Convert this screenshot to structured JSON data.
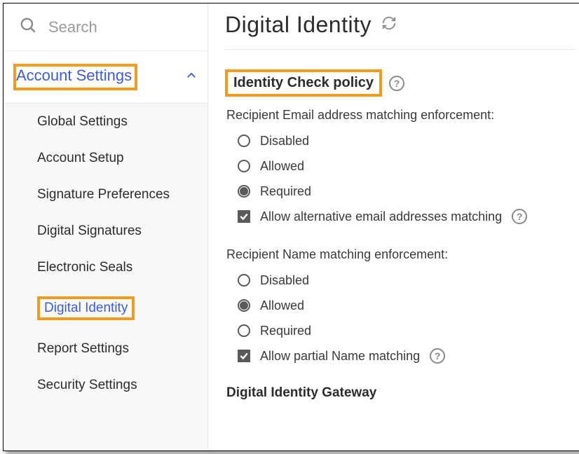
{
  "highlight_color": "#f29b1d",
  "primary_color": "#3b5be0",
  "sidebar": {
    "search_placeholder": "Search",
    "section_label": "Account Settings",
    "items": [
      {
        "label": "Global Settings",
        "active": false
      },
      {
        "label": "Account Setup",
        "active": false
      },
      {
        "label": "Signature Preferences",
        "active": false
      },
      {
        "label": "Digital Signatures",
        "active": false
      },
      {
        "label": "Electronic Seals",
        "active": false
      },
      {
        "label": "Digital Identity",
        "active": true
      },
      {
        "label": "Report Settings",
        "active": false
      },
      {
        "label": "Security Settings",
        "active": false
      }
    ]
  },
  "main": {
    "title": "Digital Identity",
    "identity_check": {
      "title": "Identity Check policy",
      "email_group_label": "Recipient Email address matching enforcement:",
      "email_options": [
        {
          "label": "Disabled",
          "selected": false
        },
        {
          "label": "Allowed",
          "selected": false
        },
        {
          "label": "Required",
          "selected": true
        }
      ],
      "email_allow_alt": {
        "label": "Allow alternative email addresses matching",
        "checked": true
      },
      "name_group_label": "Recipient Name matching enforcement:",
      "name_options": [
        {
          "label": "Disabled",
          "selected": false
        },
        {
          "label": "Allowed",
          "selected": true
        },
        {
          "label": "Required",
          "selected": false
        }
      ],
      "name_allow_partial": {
        "label": "Allow partial Name matching",
        "checked": true
      }
    },
    "gateway_title": "Digital Identity Gateway"
  }
}
